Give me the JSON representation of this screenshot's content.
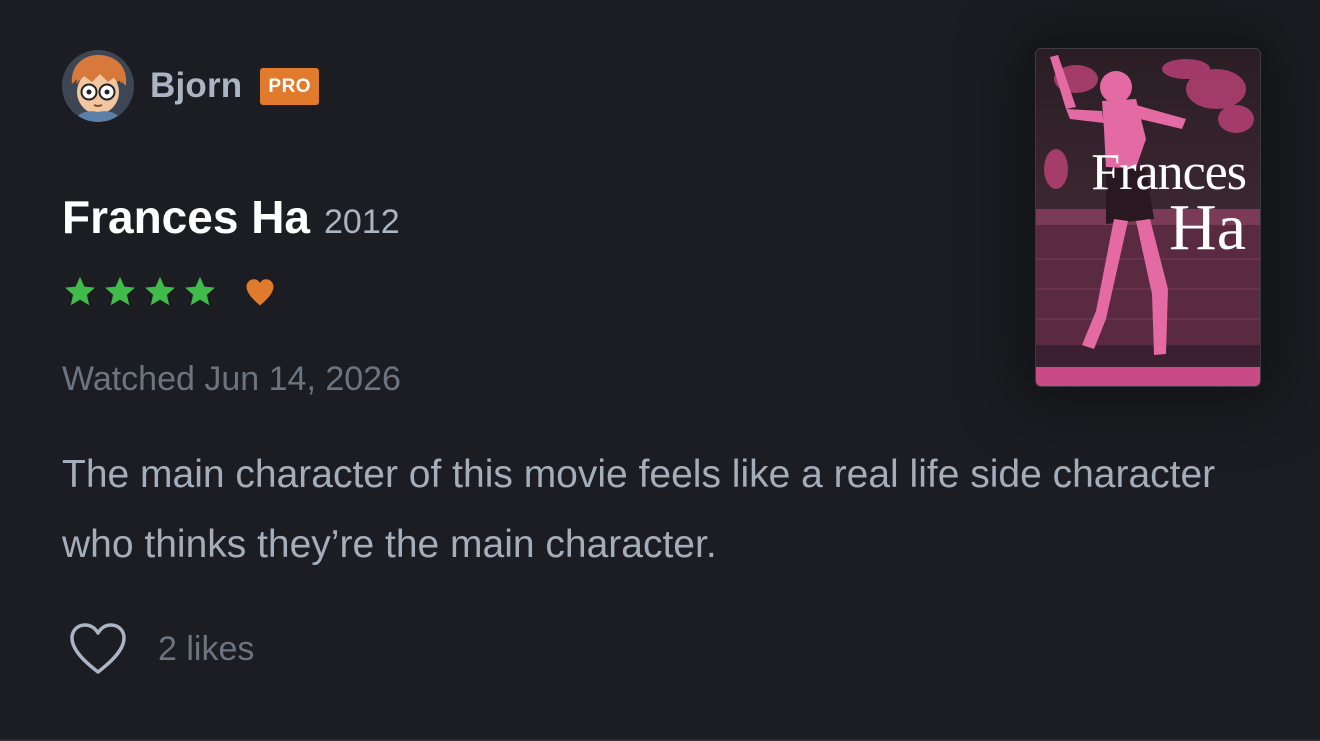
{
  "user": {
    "name": "Bjorn",
    "badge": "PRO"
  },
  "film": {
    "title": "Frances Ha",
    "year": "2012",
    "poster_title_line1": "Frances",
    "poster_title_line2": "Ha"
  },
  "rating": {
    "stars": 4,
    "max_stars": 5,
    "liked": true
  },
  "watched": "Watched Jun 14, 2026",
  "review": {
    "text": "The main character of this movie feels like a real life side character who thinks they’re the main character."
  },
  "likes": {
    "count_label": "2 likes"
  },
  "colors": {
    "background": "#1b1d22",
    "star": "#40bc4a",
    "heart": "#e07b2e",
    "badge": "#e07b2e",
    "poster_tint": "#d9518f"
  },
  "icons": {
    "like": "heart-outline-icon",
    "liked": "heart-filled-icon",
    "star": "star-icon"
  }
}
